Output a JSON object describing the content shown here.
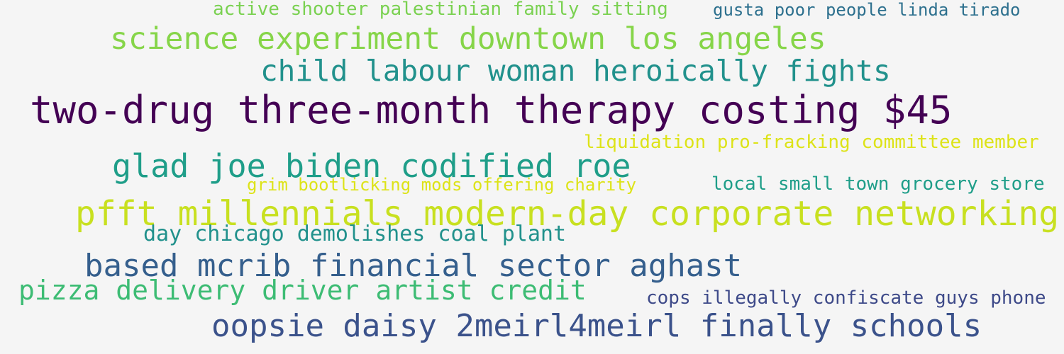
{
  "background": "#f5f5f5",
  "phrases": [
    {
      "text": "active shooter palestinian family sitting",
      "color": "#7ad151"
    },
    {
      "text": "gusta poor people linda tirado",
      "color": "#2d708e"
    },
    {
      "text": "science experiment downtown los angeles",
      "color": "#86d549"
    },
    {
      "text": "child labour woman heroically fights",
      "color": "#21918c"
    },
    {
      "text": "two-drug three-month therapy costing $45",
      "color": "#440154"
    },
    {
      "text": "liquidation pro-fracking committee member",
      "color": "#dde318"
    },
    {
      "text": "glad joe biden codified roe",
      "color": "#1f9e89"
    },
    {
      "text": "grim bootlicking mods offering charity",
      "color": "#dde318"
    },
    {
      "text": "local small town grocery store",
      "color": "#1f9e89"
    },
    {
      "text": "pfft millennials modern-day corporate networking",
      "color": "#c8e020"
    },
    {
      "text": "day chicago demolishes coal plant",
      "color": "#21918c"
    },
    {
      "text": "based mcrib financial sector aghast",
      "color": "#355f8d"
    },
    {
      "text": "pizza delivery driver artist credit",
      "color": "#3dbc74"
    },
    {
      "text": "cops illegally confiscate guys phone",
      "color": "#3e4a89"
    },
    {
      "text": "oopsie daisy 2meirl4meirl finally schools",
      "color": "#3b528b"
    }
  ]
}
